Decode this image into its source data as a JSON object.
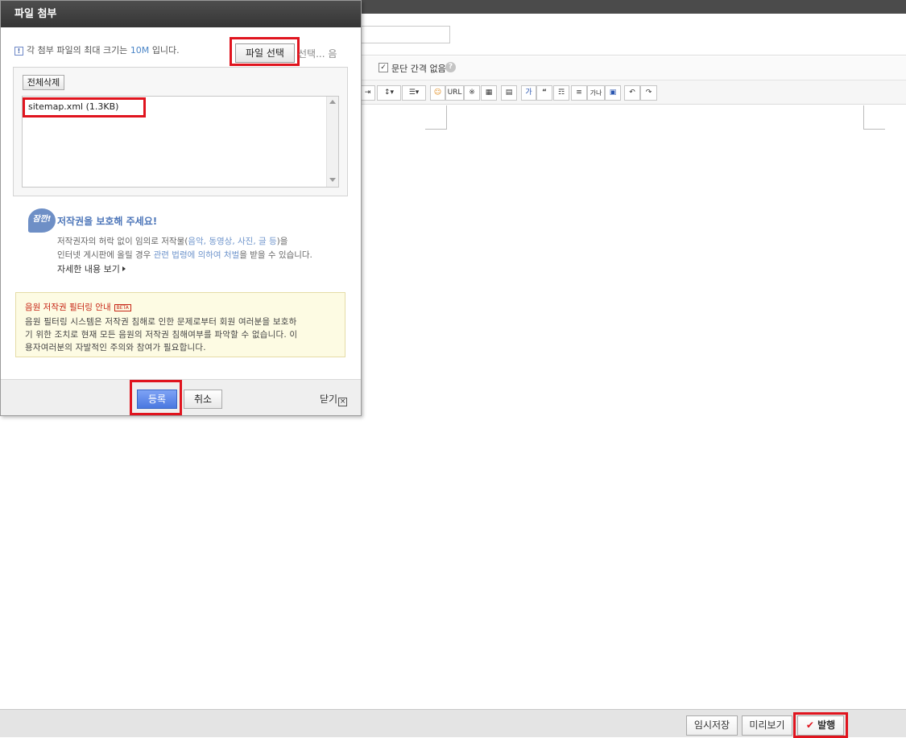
{
  "dialog": {
    "title": "파일 첨부",
    "notice_prefix": "각 첨부 파일의 최대 크기는",
    "notice_size": "10M",
    "notice_suffix": "입니다.",
    "pick_button": "파일 선택",
    "pick_status": "선택... 음",
    "delete_all_button": "전체삭제",
    "files": [
      "sitemap.xml (1.3KB)"
    ],
    "copyright_badge": "잠깐!",
    "copyright_title": "저작권을 보호해 주세요!",
    "copyright_line1_a": "저작권자의 허락 없이 임의로 저작물(",
    "copyright_line1_hl": "음악, 동영상, 사진, 글 등",
    "copyright_line1_b": ")을",
    "copyright_line2_a": "인터넷 게시판에 올릴 경우",
    "copyright_line2_hl": "관련 법령에 의하여 처벌",
    "copyright_line2_b": "을 받을 수 있습니다.",
    "copyright_more": "자세한 내용 보기",
    "filter_title": "음원 저작권 필터링 안내",
    "filter_badge": "BETA",
    "filter_line1": "음원 필터링 시스템은 저작권 침해로 인한 문제로부터 회원 여러분을 보호하",
    "filter_line2": "기 위한 조치로 현재 모든 음원의 저작권 침해여부를 파악할 수 없습니다. 이",
    "filter_line3": "용자여러분의 자발적인 주의와 참여가 필요합니다.",
    "ok_button": "등록",
    "cancel_button": "취소",
    "close_label": "닫기",
    "close_x": "×"
  },
  "editor": {
    "paragraph_option": "문단 간격 없음",
    "help_icon": "?",
    "checkbox_mark": "✓",
    "toolbar": [
      "align",
      "line-height",
      "list",
      "emoticon",
      "URL",
      "※",
      "table",
      "layout",
      "가",
      "“",
      "rule",
      "divider",
      "hanja",
      "spell",
      "undo",
      "redo"
    ],
    "toolbar_url": "URL",
    "toolbar_symbol": "※",
    "toolbar_text": "가",
    "toolbar_quote": "66",
    "toolbar_hanja": "가나"
  },
  "bottom": {
    "save_draft": "임시저장",
    "preview": "미리보기",
    "publish": "발행",
    "publish_check": "✔"
  },
  "colors": {
    "highlight_box": "#e0141e",
    "primary_button": "#4a78e0",
    "link_blue": "#4d76b9"
  }
}
